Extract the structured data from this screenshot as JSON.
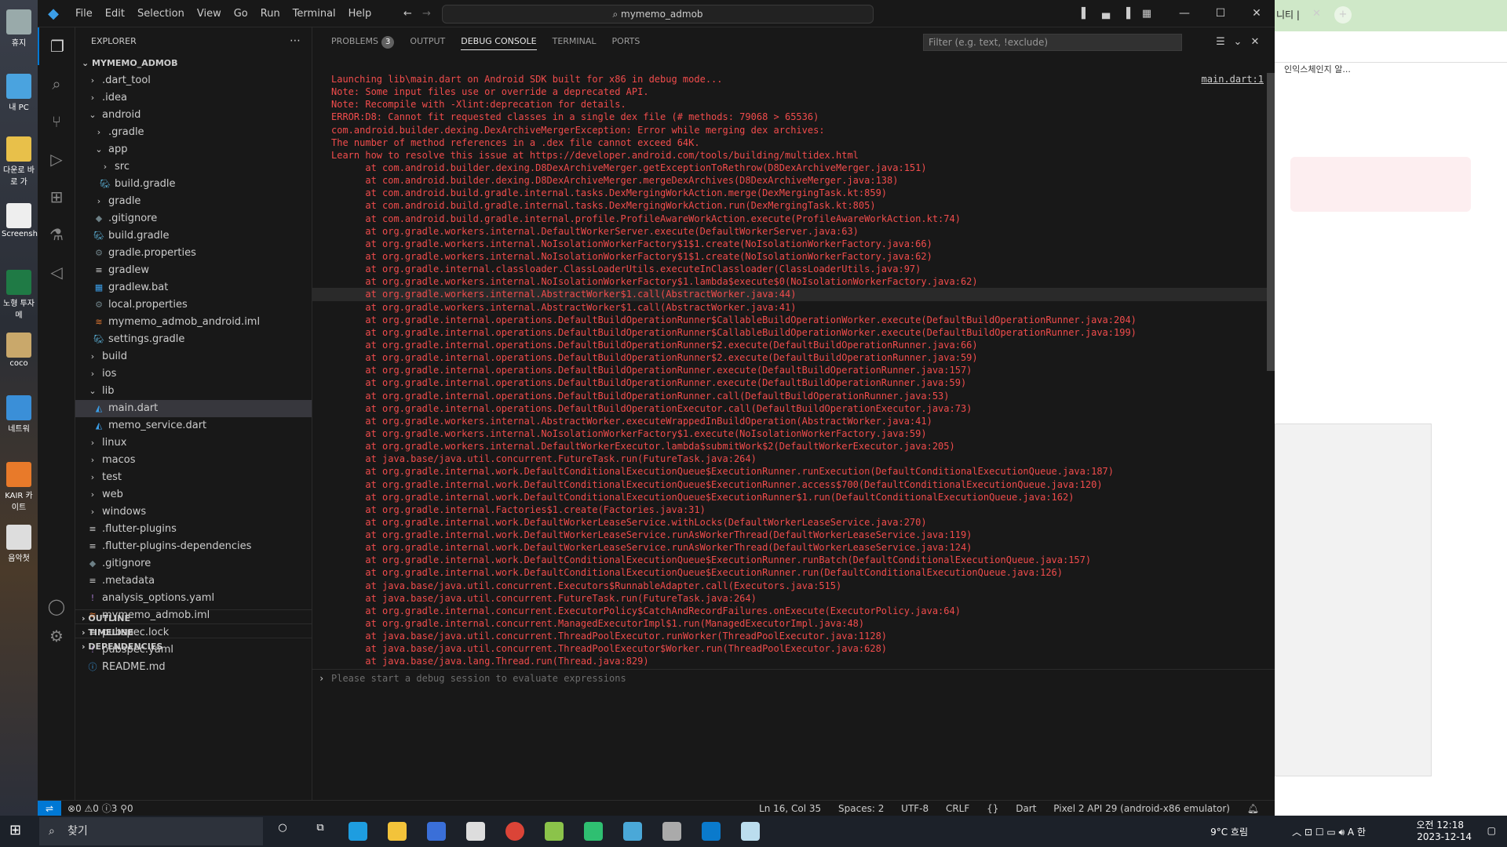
{
  "window": {
    "title": "mymemo_admob"
  },
  "menu": [
    "File",
    "Edit",
    "Selection",
    "View",
    "Go",
    "Run",
    "Terminal",
    "Help"
  ],
  "sidebar": {
    "title": "EXPLORER",
    "root": "MYMEMO_ADMOB",
    "items": [
      {
        "label": ".dart_tool",
        "depth": 0,
        "type": "folder",
        "open": false
      },
      {
        "label": ".idea",
        "depth": 0,
        "type": "folder",
        "open": false
      },
      {
        "label": "android",
        "depth": 0,
        "type": "folder",
        "open": true
      },
      {
        "label": ".gradle",
        "depth": 1,
        "type": "folder",
        "open": false
      },
      {
        "label": "app",
        "depth": 1,
        "type": "folder",
        "open": true
      },
      {
        "label": "src",
        "depth": 2,
        "type": "folder",
        "open": false
      },
      {
        "label": "build.gradle",
        "depth": 2,
        "type": "gradle"
      },
      {
        "label": "gradle",
        "depth": 1,
        "type": "folder",
        "open": false
      },
      {
        "label": ".gitignore",
        "depth": 1,
        "type": "git"
      },
      {
        "label": "build.gradle",
        "depth": 1,
        "type": "gradle"
      },
      {
        "label": "gradle.properties",
        "depth": 1,
        "type": "gear"
      },
      {
        "label": "gradlew",
        "depth": 1,
        "type": "file"
      },
      {
        "label": "gradlew.bat",
        "depth": 1,
        "type": "win"
      },
      {
        "label": "local.properties",
        "depth": 1,
        "type": "gear"
      },
      {
        "label": "mymemo_admob_android.iml",
        "depth": 1,
        "type": "rss"
      },
      {
        "label": "settings.gradle",
        "depth": 1,
        "type": "gradle"
      },
      {
        "label": "build",
        "depth": 0,
        "type": "folder",
        "open": false
      },
      {
        "label": "ios",
        "depth": 0,
        "type": "folder",
        "open": false
      },
      {
        "label": "lib",
        "depth": 0,
        "type": "folder",
        "open": true
      },
      {
        "label": "main.dart",
        "depth": 1,
        "type": "dart",
        "selected": true
      },
      {
        "label": "memo_service.dart",
        "depth": 1,
        "type": "dart"
      },
      {
        "label": "linux",
        "depth": 0,
        "type": "folder",
        "open": false
      },
      {
        "label": "macos",
        "depth": 0,
        "type": "folder",
        "open": false
      },
      {
        "label": "test",
        "depth": 0,
        "type": "folder",
        "open": false
      },
      {
        "label": "web",
        "depth": 0,
        "type": "folder",
        "open": false
      },
      {
        "label": "windows",
        "depth": 0,
        "type": "folder",
        "open": false
      },
      {
        "label": ".flutter-plugins",
        "depth": 0,
        "type": "file"
      },
      {
        "label": ".flutter-plugins-dependencies",
        "depth": 0,
        "type": "file"
      },
      {
        "label": ".gitignore",
        "depth": 0,
        "type": "git"
      },
      {
        "label": ".metadata",
        "depth": 0,
        "type": "file"
      },
      {
        "label": "analysis_options.yaml",
        "depth": 0,
        "type": "yaml"
      },
      {
        "label": "mymemo_admob.iml",
        "depth": 0,
        "type": "rss"
      },
      {
        "label": "pubspec.lock",
        "depth": 0,
        "type": "file"
      },
      {
        "label": "pubspec.yaml",
        "depth": 0,
        "type": "yaml"
      },
      {
        "label": "README.md",
        "depth": 0,
        "type": "info"
      }
    ],
    "sections": [
      "OUTLINE",
      "TIMELINE",
      "DEPENDENCIES"
    ]
  },
  "panel": {
    "tabs": [
      {
        "label": "PROBLEMS",
        "badge": "3"
      },
      {
        "label": "OUTPUT"
      },
      {
        "label": "DEBUG CONSOLE",
        "active": true
      },
      {
        "label": "TERMINAL"
      },
      {
        "label": "PORTS"
      }
    ],
    "filter_placeholder": "Filter (e.g. text, !exclude)",
    "source_link": "main.dart:1",
    "input_placeholder": "Please start a debug session to evaluate expressions",
    "lines": [
      "Launching lib\\main.dart on Android SDK built for x86 in debug mode...",
      "Note: Some input files use or override a deprecated API.",
      "Note: Recompile with -Xlint:deprecation for details.",
      "ERROR:D8: Cannot fit requested classes in a single dex file (# methods: 79068 > 65536)",
      "com.android.builder.dexing.DexArchiveMergerException: Error while merging dex archives:",
      "The number of method references in a .dex file cannot exceed 64K.",
      "Learn how to resolve this issue at https://developer.android.com/tools/building/multidex.html",
      "\tat com.android.builder.dexing.D8DexArchiveMerger.getExceptionToRethrow(D8DexArchiveMerger.java:151)",
      "\tat com.android.builder.dexing.D8DexArchiveMerger.mergeDexArchives(D8DexArchiveMerger.java:138)",
      "\tat com.android.build.gradle.internal.tasks.DexMergingWorkAction.merge(DexMergingTask.kt:859)",
      "\tat com.android.build.gradle.internal.tasks.DexMergingWorkAction.run(DexMergingTask.kt:805)",
      "\tat com.android.build.gradle.internal.profile.ProfileAwareWorkAction.execute(ProfileAwareWorkAction.kt:74)",
      "\tat org.gradle.workers.internal.DefaultWorkerServer.execute(DefaultWorkerServer.java:63)",
      "\tat org.gradle.workers.internal.NoIsolationWorkerFactory$1$1.create(NoIsolationWorkerFactory.java:66)",
      "\tat org.gradle.workers.internal.NoIsolationWorkerFactory$1$1.create(NoIsolationWorkerFactory.java:62)",
      "\tat org.gradle.internal.classloader.ClassLoaderUtils.executeInClassloader(ClassLoaderUtils.java:97)",
      "\tat org.gradle.workers.internal.NoIsolationWorkerFactory$1.lambda$execute$0(NoIsolationWorkerFactory.java:62)",
      "\tat org.gradle.workers.internal.AbstractWorker$1.call(AbstractWorker.java:44)",
      "\tat org.gradle.workers.internal.AbstractWorker$1.call(AbstractWorker.java:41)",
      "\tat org.gradle.internal.operations.DefaultBuildOperationRunner$CallableBuildOperationWorker.execute(DefaultBuildOperationRunner.java:204)",
      "\tat org.gradle.internal.operations.DefaultBuildOperationRunner$CallableBuildOperationWorker.execute(DefaultBuildOperationRunner.java:199)",
      "\tat org.gradle.internal.operations.DefaultBuildOperationRunner$2.execute(DefaultBuildOperationRunner.java:66)",
      "\tat org.gradle.internal.operations.DefaultBuildOperationRunner$2.execute(DefaultBuildOperationRunner.java:59)",
      "\tat org.gradle.internal.operations.DefaultBuildOperationRunner.execute(DefaultBuildOperationRunner.java:157)",
      "\tat org.gradle.internal.operations.DefaultBuildOperationRunner.execute(DefaultBuildOperationRunner.java:59)",
      "\tat org.gradle.internal.operations.DefaultBuildOperationRunner.call(DefaultBuildOperationRunner.java:53)",
      "\tat org.gradle.internal.operations.DefaultBuildOperationExecutor.call(DefaultBuildOperationExecutor.java:73)",
      "\tat org.gradle.workers.internal.AbstractWorker.executeWrappedInBuildOperation(AbstractWorker.java:41)",
      "\tat org.gradle.workers.internal.NoIsolationWorkerFactory$1.execute(NoIsolationWorkerFactory.java:59)",
      "\tat org.gradle.workers.internal.DefaultWorkerExecutor.lambda$submitWork$2(DefaultWorkerExecutor.java:205)",
      "\tat java.base/java.util.concurrent.FutureTask.run(FutureTask.java:264)",
      "\tat org.gradle.internal.work.DefaultConditionalExecutionQueue$ExecutionRunner.runExecution(DefaultConditionalExecutionQueue.java:187)",
      "\tat org.gradle.internal.work.DefaultConditionalExecutionQueue$ExecutionRunner.access$700(DefaultConditionalExecutionQueue.java:120)",
      "\tat org.gradle.internal.work.DefaultConditionalExecutionQueue$ExecutionRunner$1.run(DefaultConditionalExecutionQueue.java:162)",
      "\tat org.gradle.internal.Factories$1.create(Factories.java:31)",
      "\tat org.gradle.internal.work.DefaultWorkerLeaseService.withLocks(DefaultWorkerLeaseService.java:270)",
      "\tat org.gradle.internal.work.DefaultWorkerLeaseService.runAsWorkerThread(DefaultWorkerLeaseService.java:119)",
      "\tat org.gradle.internal.work.DefaultWorkerLeaseService.runAsWorkerThread(DefaultWorkerLeaseService.java:124)",
      "\tat org.gradle.internal.work.DefaultConditionalExecutionQueue$ExecutionRunner.runBatch(DefaultConditionalExecutionQueue.java:157)",
      "\tat org.gradle.internal.work.DefaultConditionalExecutionQueue$ExecutionRunner.run(DefaultConditionalExecutionQueue.java:126)",
      "\tat java.base/java.util.concurrent.Executors$RunnableAdapter.call(Executors.java:515)",
      "\tat java.base/java.util.concurrent.FutureTask.run(FutureTask.java:264)",
      "\tat org.gradle.internal.concurrent.ExecutorPolicy$CatchAndRecordFailures.onExecute(ExecutorPolicy.java:64)",
      "\tat org.gradle.internal.concurrent.ManagedExecutorImpl$1.run(ManagedExecutorImpl.java:48)",
      "\tat java.base/java.util.concurrent.ThreadPoolExecutor.runWorker(ThreadPoolExecutor.java:1128)",
      "\tat java.base/java.util.concurrent.ThreadPoolExecutor$Worker.run(ThreadPoolExecutor.java:628)",
      "\tat java.base/java.lang.Thread.run(Thread.java:829)"
    ]
  },
  "statusbar": {
    "errors": "0",
    "warnings": "0",
    "info": "3",
    "ports": "0",
    "position": "Ln 16, Col 35",
    "spaces": "Spaces: 2",
    "encoding": "UTF-8",
    "eol": "CRLF",
    "language": "Dart",
    "device": "Pixel 2 API 29 (android-x86 emulator)"
  },
  "taskbar": {
    "search_label": "찾기",
    "weather": "9°C 흐림",
    "time": "오전 12:18",
    "date": "2023-12-14"
  },
  "chrome": {
    "tab_label": "니티 |",
    "bookmark": "인익스체인지 알..."
  },
  "desktop_icons": [
    "휴지",
    "내 PC",
    "다운로 바로 가",
    "Screensh",
    "노형 투자메",
    "coco",
    "네트워",
    "KAIR 카이트",
    "음악첫"
  ]
}
